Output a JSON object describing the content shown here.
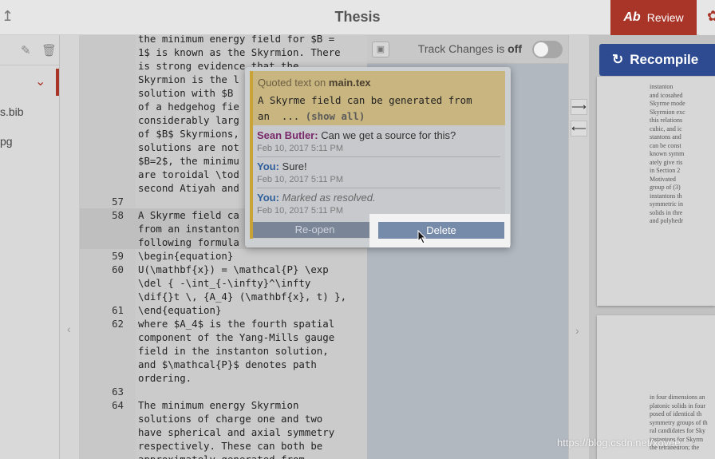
{
  "header": {
    "title": "Thesis",
    "review_label": "Review",
    "review_icon": "Ab"
  },
  "filetree": {
    "files": [
      "s.bib",
      "pg"
    ]
  },
  "editor": {
    "lines": [
      {
        "n": "",
        "t": "the minimum energy field for $B ="
      },
      {
        "n": "",
        "t": "1$ is known as the Skyrmion. There"
      },
      {
        "n": "",
        "t": "is strong evidence that the"
      },
      {
        "n": "",
        "t": "Skyrmion is the l"
      },
      {
        "n": "",
        "t": "solution with $B "
      },
      {
        "n": "",
        "t": "of a hedgehog fie"
      },
      {
        "n": "",
        "t": "considerably larg"
      },
      {
        "n": "",
        "t": "of $B$ Skyrmions,"
      },
      {
        "n": "",
        "t": "solutions are not"
      },
      {
        "n": "",
        "t": "$B=2$, the minimu"
      },
      {
        "n": "",
        "t": "are toroidal \\tod"
      },
      {
        "n": "",
        "t": "second Atiyah and"
      },
      {
        "n": "57",
        "t": ""
      },
      {
        "n": "58",
        "t": "A Skyrme field ca"
      },
      {
        "n": "",
        "t": "from an instanton"
      },
      {
        "n": "",
        "t": "following formula"
      },
      {
        "n": "59",
        "t": "\\begin{equation}"
      },
      {
        "n": "60",
        "t": "U(\\mathbf{x}) = \\mathcal{P} \\exp"
      },
      {
        "n": "",
        "t": "\\del { -\\int_{-\\infty}^\\infty"
      },
      {
        "n": "",
        "t": "\\dif{}t \\, {A_4} (\\mathbf{x}, t) },"
      },
      {
        "n": "61",
        "t": "\\end{equation}"
      },
      {
        "n": "62",
        "t": "where $A_4$ is the fourth spatial"
      },
      {
        "n": "",
        "t": "component of the Yang-Mills gauge"
      },
      {
        "n": "",
        "t": "field in the instanton solution,"
      },
      {
        "n": "",
        "t": "and $\\mathcal{P}$ denotes path"
      },
      {
        "n": "",
        "t": "ordering."
      },
      {
        "n": "63",
        "t": ""
      },
      {
        "n": "64",
        "t": "The minimum energy Skyrmion"
      },
      {
        "n": "",
        "t": "solutions of charge one and two"
      },
      {
        "n": "",
        "t": "have spherical and axial symmetry"
      },
      {
        "n": "",
        "t": "respectively. These can both be"
      },
      {
        "n": "",
        "t": "approximately generated from"
      }
    ]
  },
  "review_panel": {
    "track_changes_prefix": "Track Changes is",
    "track_changes_state": "off"
  },
  "comment": {
    "quoted_prefix": "Quoted text on",
    "quoted_file": "main.tex",
    "quoted_text": "A Skyrme field can be generated from",
    "quoted_text_2": "an  ... ",
    "show_all": "(show all)",
    "entries": [
      {
        "author": "Sean Butler:",
        "text": "Can we get a source for this?",
        "time": "Feb 10, 2017 5:11 PM"
      },
      {
        "author": "You:",
        "text": "Sure!",
        "time": "Feb 10, 2017 5:11 PM"
      },
      {
        "author": "You:",
        "text": "Marked as resolved.",
        "time": "Feb 10, 2017 5:11 PM"
      }
    ],
    "reopen_label": "Re-open",
    "delete_label": "Delete"
  },
  "pdf": {
    "recompile_label": "Recompile",
    "page1_lines": [
      "instanton",
      "and icosahed",
      "Skyrme mode",
      "Skyrmion exc",
      "this relations",
      "cubic, and ic",
      "stantons and",
      "can be const",
      "known symm",
      "ately give ris",
      "in Section 2",
      "Motivated",
      "group of (3)",
      "instantons th",
      "symmetric in",
      "solids in thre",
      "and polyhedr"
    ],
    "page2_lines": [
      "in four dimensions an",
      "platonic solids in four",
      "posed of identical th",
      "symmetry groups of th",
      "ral candidates for Sky",
      "instantons for Skyrm",
      "the tetrahedron; the"
    ]
  },
  "watermark": "https://blog.csdn.net/xovee",
  "colors": {
    "review": "#a93529",
    "recompile": "#2e4b91",
    "quote": "#c9b57f",
    "delete": "#768aa9"
  }
}
